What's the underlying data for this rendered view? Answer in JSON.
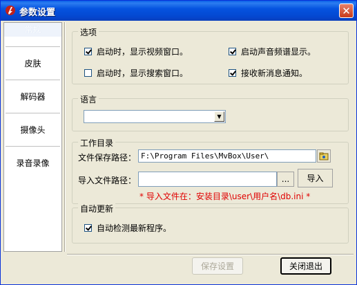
{
  "window": {
    "title": "参数设置",
    "close_glyph": "✕"
  },
  "sidebar": {
    "items": [
      {
        "label": "常规",
        "active": true
      },
      {
        "label": "皮肤"
      },
      {
        "label": "解码器"
      },
      {
        "label": "摄像头"
      },
      {
        "label": "录音录像"
      }
    ]
  },
  "options": {
    "title": "选项",
    "items": [
      {
        "label": "启动时，显示视频窗口。",
        "checked": true
      },
      {
        "label": "启动声音频谱显示。",
        "checked": true
      },
      {
        "label": "启动时，显示搜索窗口。",
        "checked": false
      },
      {
        "label": "接收新消息通知。",
        "checked": true
      }
    ]
  },
  "language": {
    "title": "语言",
    "selected": ""
  },
  "workdir": {
    "title": "工作目录",
    "save_path_label": "文件保存路径：",
    "save_path_value": "F:\\Program Files\\MvBox\\User\\",
    "import_path_label": "导入文件路径：",
    "import_path_value": "",
    "browse_label": "...",
    "import_button": "导入",
    "note": "* 导入文件在：安装目录\\user\\用户名\\db.ini *"
  },
  "autoupdate": {
    "title": "自动更新",
    "item": {
      "label": "自动检测最新程序。",
      "checked": true
    }
  },
  "footer": {
    "save_button": "保存设置",
    "close_button": "关闭退出"
  },
  "icons": {
    "app": "app-logo-icon",
    "folder": "folder-icon",
    "close": "close-icon"
  },
  "colors": {
    "titlebar": "#0553e0",
    "note": "#e00000",
    "window_bg": "#ece9d8"
  }
}
